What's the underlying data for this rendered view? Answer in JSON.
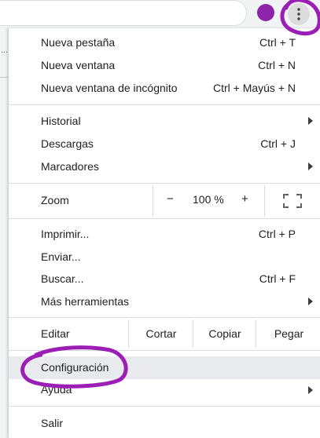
{
  "browser": {
    "accent_color": "#8e24aa",
    "menu_button_icon": "three-dots-vertical-icon"
  },
  "menu": {
    "new_tab": {
      "label": "Nueva pestaña",
      "shortcut": "Ctrl + T"
    },
    "new_window": {
      "label": "Nueva ventana",
      "shortcut": "Ctrl + N"
    },
    "incognito": {
      "label": "Nueva ventana de incógnito",
      "shortcut": "Ctrl + Mayús + N"
    },
    "history": {
      "label": "Historial"
    },
    "downloads": {
      "label": "Descargas",
      "shortcut": "Ctrl + J"
    },
    "bookmarks": {
      "label": "Marcadores"
    },
    "zoom": {
      "label": "Zoom",
      "minus": "−",
      "value": "100 %",
      "plus": "+"
    },
    "print": {
      "label": "Imprimir...",
      "shortcut": "Ctrl + P"
    },
    "cast": {
      "label": "Enviar..."
    },
    "find": {
      "label": "Buscar...",
      "shortcut": "Ctrl + F"
    },
    "more_tools": {
      "label": "Más herramientas"
    },
    "edit": {
      "label": "Editar",
      "cut": "Cortar",
      "copy": "Copiar",
      "paste": "Pegar"
    },
    "settings": {
      "label": "Configuración"
    },
    "help": {
      "label": "Ayuda"
    },
    "exit": {
      "label": "Salir"
    }
  },
  "annotation": {
    "color": "#9c1fb5"
  }
}
